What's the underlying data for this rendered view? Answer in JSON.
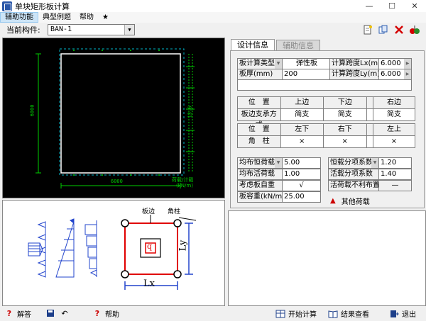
{
  "window": {
    "title": "单块矩形板计算",
    "minimize": "—",
    "maximize": "☐",
    "close": "✕"
  },
  "menu": {
    "items": [
      "辅助功能",
      "典型例题",
      "帮助",
      "★"
    ]
  },
  "toolbar": {
    "component_label": "当前构件:",
    "component_value": "BAN-1",
    "icons": [
      "new-file-icon",
      "copy-icon",
      "delete-icon",
      "calculate-icon"
    ]
  },
  "drawing": {
    "dim_left": "6000",
    "dim_bottom": "6000",
    "dim_right": "13.6",
    "load_label_1": "荷载/计载",
    "load_label_2": "(kN/m)"
  },
  "diagram": {
    "label_plate_edge": "板边",
    "label_corner_column": "角柱",
    "label_q": "q",
    "label_lx": "Lx",
    "label_ly": "Ly"
  },
  "tabs": {
    "design_info": "设计信息",
    "aux_info": "辅助信息"
  },
  "design": {
    "calc_type_label": "板计算类型",
    "calc_type_value": "弹性板",
    "span_lx_label": "计算跨度Lx(m)",
    "span_lx_value": "6.000",
    "thickness_label": "板厚(mm)",
    "thickness_value": "200",
    "span_ly_label": "计算跨度Ly(m)",
    "span_ly_value": "6.000"
  },
  "edge_table": {
    "headers": [
      "位　置",
      "上边",
      "下边",
      "左边",
      "右边"
    ],
    "row_label": "板边支承方式",
    "row_values": [
      "简支",
      "简支",
      "简支",
      "简支"
    ]
  },
  "corner_table": {
    "headers": [
      "位　置",
      "左下",
      "右下",
      "右上",
      "左上"
    ],
    "row_label": "角　柱",
    "row_values": [
      "×",
      "×",
      "×",
      "×"
    ]
  },
  "loads": {
    "dead_label": "均布恒荷载",
    "dead_value": "5.00",
    "live_label": "均布活荷载",
    "live_value": "1.00",
    "self_weight_label": "考虑板自重",
    "self_weight_value": "√",
    "density_label": "板容重(kN/m3)",
    "density_value": "25.00",
    "dead_factor_label": "恒载分项系数",
    "dead_factor_value": "1.20",
    "live_factor_label": "活载分项系数",
    "live_factor_value": "1.40",
    "live_adverse_label": "活荷载不利布置",
    "live_adverse_value": "—",
    "other_loads_label": "其他荷载",
    "other_loads_marker": "▲"
  },
  "statusbar": {
    "explain": "解答",
    "help": "帮助",
    "start_calc": "开始计算",
    "view_results": "结果查看",
    "exit": "退出"
  }
}
